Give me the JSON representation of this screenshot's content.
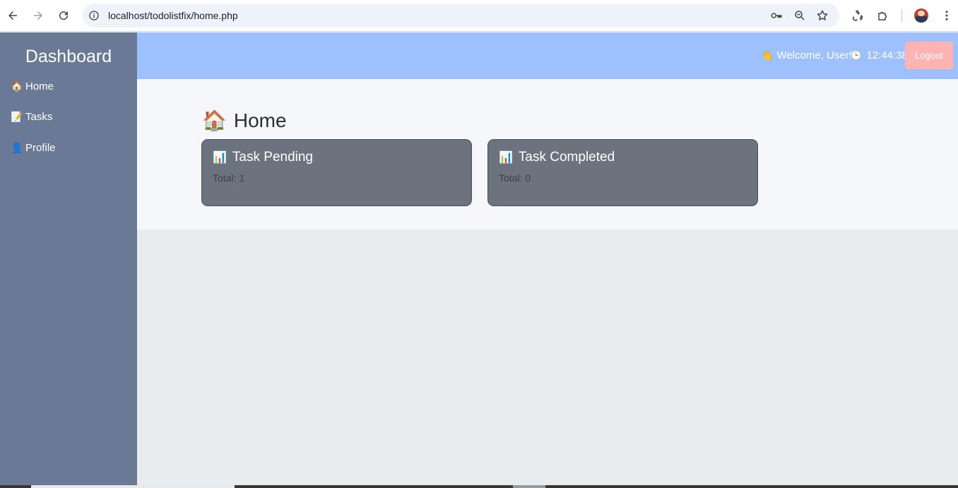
{
  "browser": {
    "url": "localhost/todolistfix/home.php",
    "icons": [
      "back-icon",
      "forward-icon",
      "reload-icon",
      "site-info-icon",
      "key-icon",
      "zoom-icon",
      "star-icon",
      "recycle-extension-icon",
      "puzzle-icon",
      "profile-avatar",
      "kebab-menu-icon"
    ]
  },
  "sidebar": {
    "title": "Dashboard",
    "items": [
      {
        "icon": "🏠",
        "label": "Home"
      },
      {
        "icon": "📝",
        "label": "Tasks"
      },
      {
        "icon": "👤",
        "label": "Profile"
      }
    ]
  },
  "header": {
    "welcome_icon": "👋",
    "welcome_text": "Welcome, User!",
    "clock_icon": "🕒",
    "time": "12:44:38",
    "logout_label": "Logout"
  },
  "main": {
    "title_icon": "🏠",
    "title": "Home",
    "cards": [
      {
        "icon": "📊",
        "title": "Task Pending",
        "total": "Total: 1"
      },
      {
        "icon": "📊",
        "title": "Task Completed",
        "total": "Total: 0"
      }
    ]
  },
  "colors": {
    "sidebar_bg": "#6a7a96",
    "header_bg": "#9ec1fd",
    "card_bg": "#6c737e",
    "logout_bg": "#ffb3b3"
  }
}
